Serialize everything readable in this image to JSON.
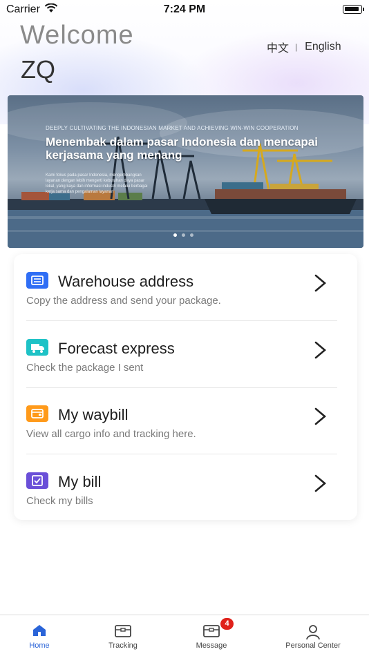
{
  "status_bar": {
    "carrier": "Carrier",
    "time": "7:24 PM"
  },
  "header": {
    "welcome": "Welcome",
    "username": "ZQ"
  },
  "language": {
    "chinese": "中文",
    "separator": "|",
    "english": "English"
  },
  "banner": {
    "eyebrow": "DEEPLY CULTIVATING THE INDONESIAN MARKET AND ACHIEVING WIN-WIN COOPERATION",
    "headline": "Menembak dalam pasar Indonesia dan mencapai kerjasama yang menang",
    "body": "Kami fokus pada pasar Indonesia, mengembangkan layanan dengan lebih mengerti kebutuhan daya pasar lokal, yang kaya dan informasi industri melalui berbagai kerja sama dan pengalaman layanan",
    "slide_count": 3,
    "active_slide": 1
  },
  "menu": [
    {
      "icon": "warehouse-icon",
      "color": "#2f6ef5",
      "title": "Warehouse address",
      "subtitle": "Copy the address and send your package."
    },
    {
      "icon": "truck-icon",
      "color": "#1ec2c6",
      "title": "Forecast express",
      "subtitle": "Check the package I sent"
    },
    {
      "icon": "wallet-icon",
      "color": "#ff9a1a",
      "title": "My waybill",
      "subtitle": "View all cargo info and tracking here."
    },
    {
      "icon": "bill-icon",
      "color": "#6a4fd8",
      "title": "My bill",
      "subtitle": "Check my bills"
    }
  ],
  "tabs": [
    {
      "label": "Home",
      "icon": "home-icon",
      "active": true
    },
    {
      "label": "Tracking",
      "icon": "tracking-icon",
      "active": false
    },
    {
      "label": "Message",
      "icon": "message-icon",
      "active": false,
      "badge": "4"
    },
    {
      "label": "Personal Center",
      "icon": "person-icon",
      "active": false
    }
  ],
  "colors": {
    "accent": "#2a64d8",
    "badge": "#e0211b"
  }
}
